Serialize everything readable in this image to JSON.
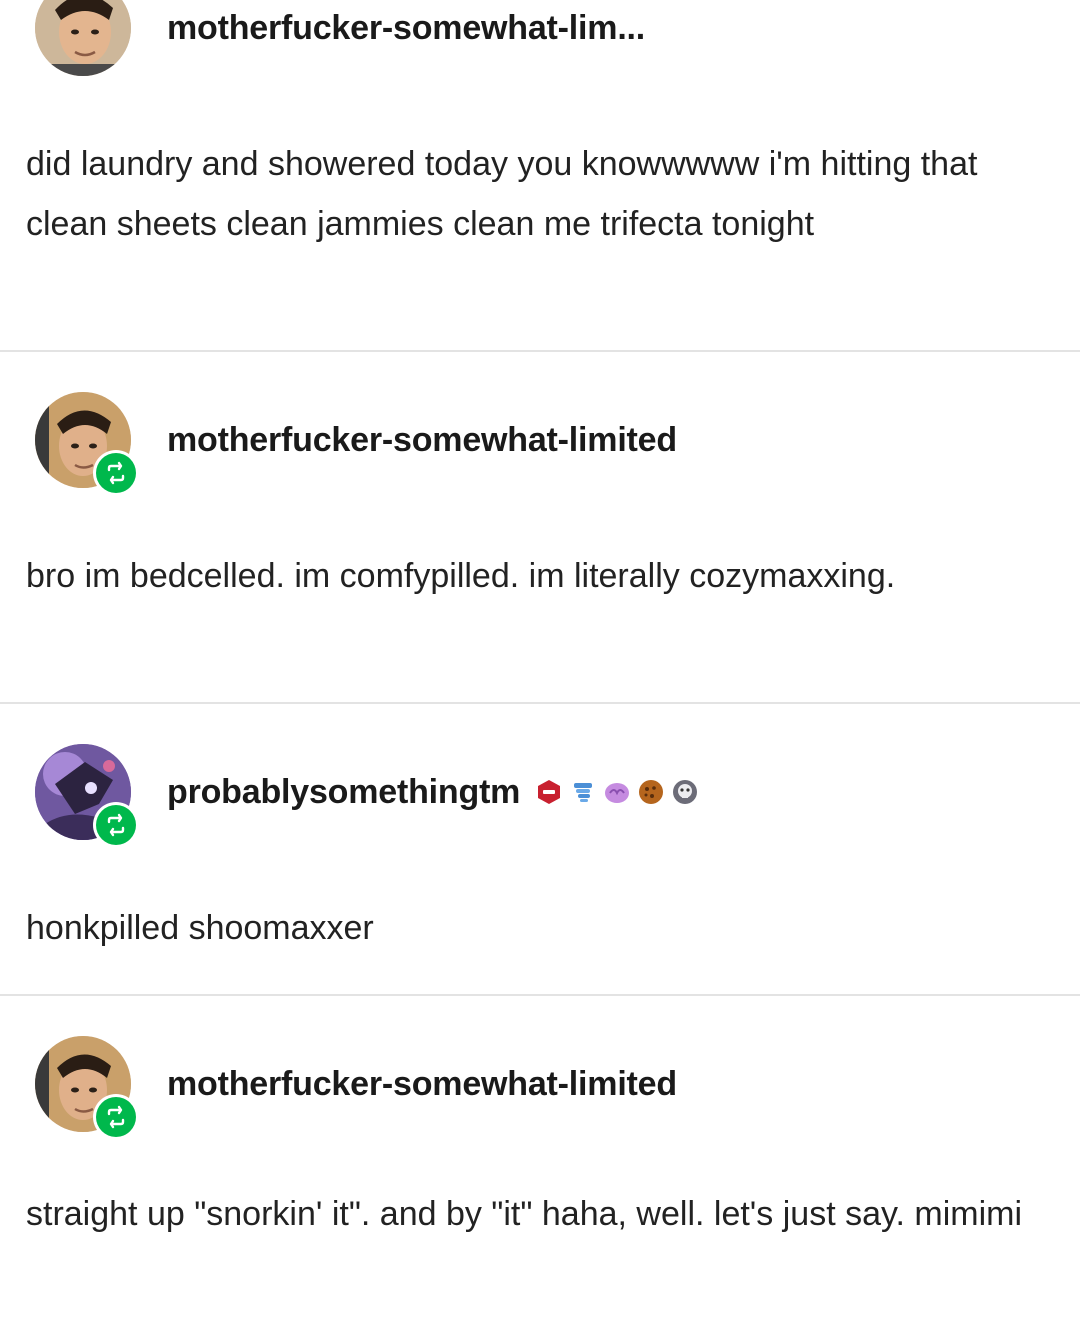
{
  "posts": [
    {
      "username": "motherfucker-somewhat-lim...",
      "reblog": false,
      "text": "did laundry and showered today you knowwwww i'm hitting that clean sheets clean jammies clean me trifecta tonight"
    },
    {
      "username": "motherfucker-somewhat-limited",
      "reblog": true,
      "text": "bro im bedcelled. im comfypilled. im literally cozymaxxing."
    },
    {
      "username": "probablysomethingtm",
      "reblog": true,
      "badges": [
        "red-hexagon-badge-icon",
        "blue-creature-badge-icon",
        "purple-brain-badge-icon",
        "brown-cookie-badge-icon",
        "grey-skull-badge-icon"
      ],
      "text": "honkpilled shoomaxxer"
    },
    {
      "username": "motherfucker-somewhat-limited",
      "reblog": true,
      "text": "straight up \"snorkin' it\". and by \"it\" haha, well. let's just say. mimimi"
    }
  ],
  "colors": {
    "reblog_badge": "#00b84c",
    "divider": "#e3e3e3",
    "text": "#222222"
  }
}
